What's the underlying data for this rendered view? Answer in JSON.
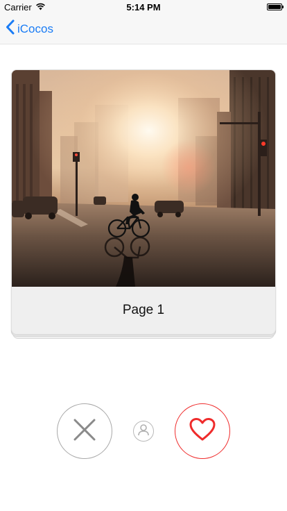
{
  "status_bar": {
    "carrier": "Carrier",
    "time": "5:14 PM",
    "icons": [
      "wifi-icon",
      "battery-icon"
    ]
  },
  "nav": {
    "back_label": "iCocos",
    "back_icon": "chevron-left-icon",
    "accent_color": "#1a7cf5"
  },
  "card": {
    "title": "Page 1",
    "image": "city-street-cyclist-sunset-photo"
  },
  "actions": {
    "dislike_icon": "close-icon",
    "profile_icon": "user-icon",
    "like_icon": "heart-icon",
    "like_color": "#ef2b2b"
  }
}
